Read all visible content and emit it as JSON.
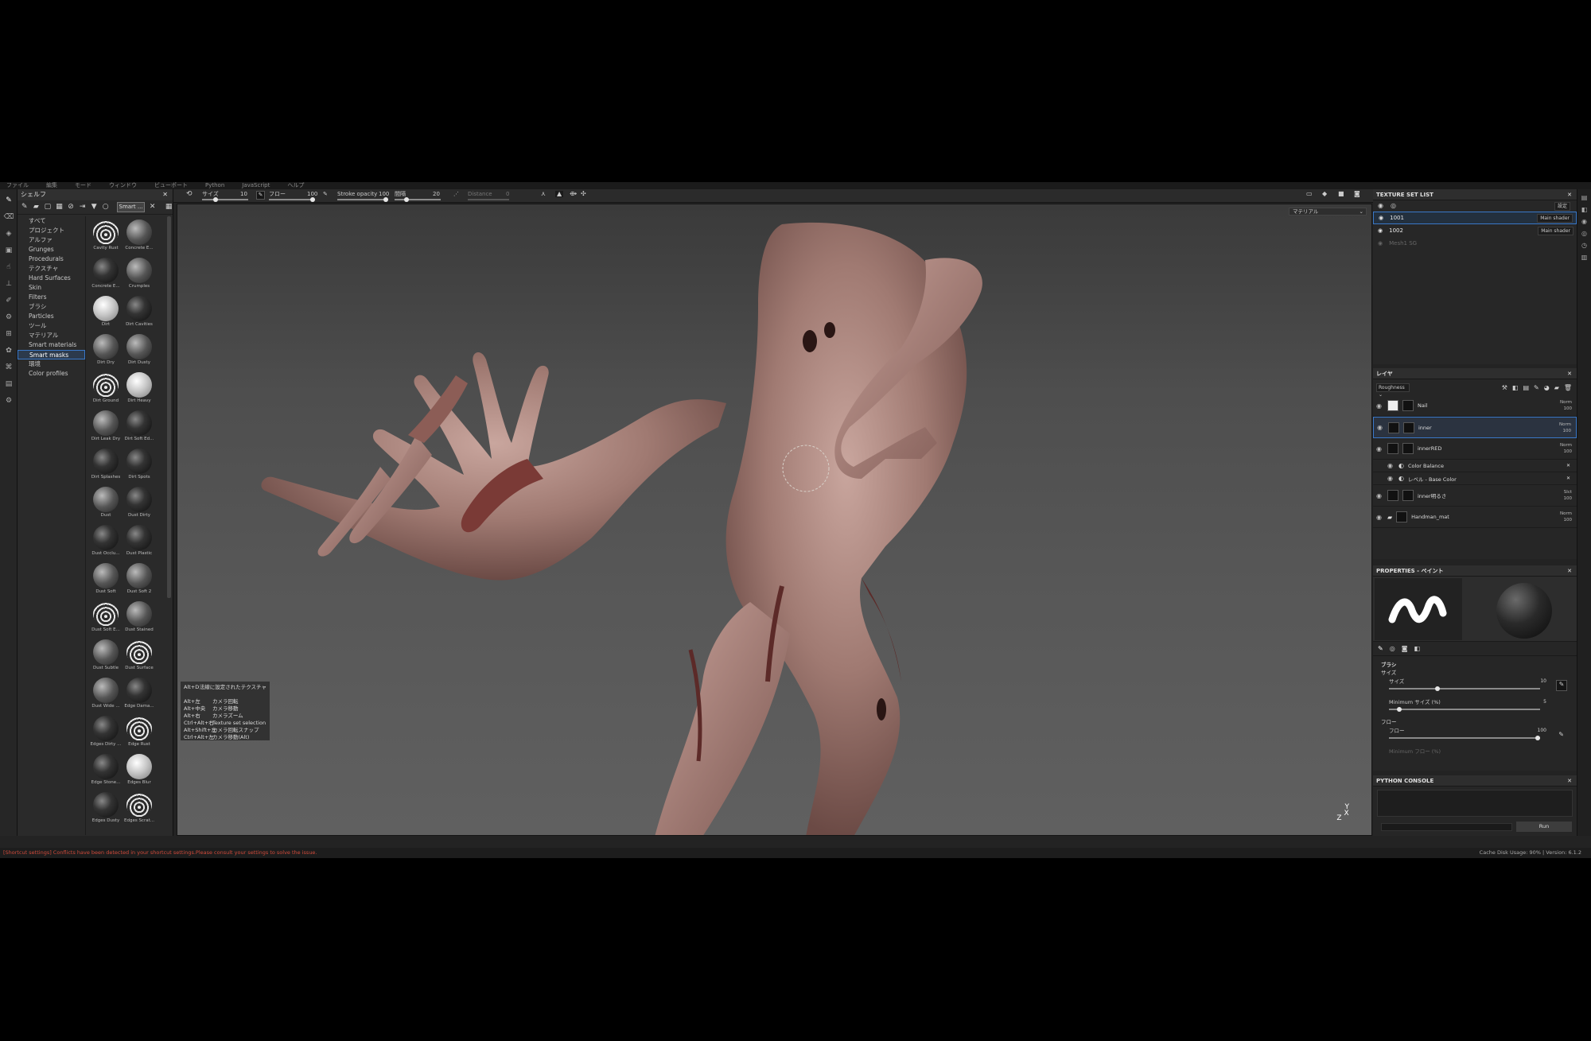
{
  "menu": [
    "ファイル",
    "編集",
    "モード",
    "ウィンドウ",
    "ビューポート",
    "Python",
    "JavaScript",
    "ヘルプ"
  ],
  "shelf": {
    "title": "シェルフ",
    "search_value": "Smart ...",
    "categories": [
      "すべて",
      "プロジェクト",
      "アルファ",
      "Grunges",
      "Procedurals",
      "テクスチャ",
      "Hard Surfaces",
      "Skin",
      "Filters",
      "ブラシ",
      "Particles",
      "ツール",
      "マテリアル",
      "Smart materials",
      "Smart masks",
      "環境",
      "Color profiles"
    ],
    "selected_category": "Smart masks",
    "items": [
      "Cavity Rust",
      "Concrete E...",
      "Concrete E...",
      "Crumples",
      "Dirt",
      "Dirt Cavities",
      "Dirt Dry",
      "Dirt Dusty",
      "Dirt Ground",
      "Dirt Heavy",
      "Dirt Leak Dry",
      "Dirt Soft Ed...",
      "Dirt Splashes",
      "Dirt Spots",
      "Dust",
      "Dust Dirty",
      "Dust Occlu...",
      "Dust Plastic",
      "Dust Soft",
      "Dust Soft 2",
      "Dust Soft E...",
      "Dust Stained",
      "Dust Subtle",
      "Dust Surface",
      "Dust Wide ...",
      "Edge Dama...",
      "Edges Dirty ...",
      "Edge Rust",
      "Edge Stone...",
      "Edges Blur",
      "Edges Dusty",
      "Edges Scrat..."
    ]
  },
  "toolbar": {
    "size_label": "サイズ",
    "size_value": "10",
    "flow_label": "フロー",
    "flow_value": "100",
    "stroke_opacity_label": "Stroke opacity",
    "stroke_opacity_value": "100",
    "spacing_label": "間隔",
    "spacing_value": "20",
    "distance_label": "Distance",
    "distance_value": "0"
  },
  "viewport": {
    "mode_select": "マテリアル",
    "shortcuts": [
      {
        "key": "Alt+D",
        "desc": "法線に設定されたテクスチャ"
      },
      {
        "key": "Alt+左",
        "desc": "カメラ回転"
      },
      {
        "key": "Alt+中央",
        "desc": "カメラ移動"
      },
      {
        "key": "Alt+右",
        "desc": "カメラズーム"
      },
      {
        "key": "Ctrl+Alt+右",
        "desc": "Texture set selection"
      },
      {
        "key": "Alt+Shift+左",
        "desc": "カメラ回転スナップ"
      },
      {
        "key": "Ctrl+Alt+左",
        "desc": "カメラ移動(Alt)"
      }
    ],
    "axis_labels": [
      "Z",
      "X",
      "Y"
    ]
  },
  "texture_set_list": {
    "title": "TEXTURE SET LIST",
    "settings_label": "設定",
    "sets": [
      {
        "name": "1001",
        "shader": "Main shader",
        "selected": true
      },
      {
        "name": "1002",
        "shader": "Main shader",
        "selected": false
      },
      {
        "name": "Mesh1 SG",
        "shader": "",
        "selected": false
      }
    ]
  },
  "layers": {
    "title": "レイヤ",
    "channel": "Roughness",
    "items": [
      {
        "name": "Nail",
        "blend": "Norm",
        "opacity": "100",
        "type": "paint",
        "selected": false
      },
      {
        "name": "inner",
        "blend": "Norm",
        "opacity": "100",
        "type": "paint",
        "selected": true
      },
      {
        "name": "innerRED",
        "blend": "Norm",
        "opacity": "100",
        "type": "fill",
        "selected": false
      },
      {
        "name": "Color Balance",
        "blend": "",
        "opacity": "",
        "type": "sub",
        "selected": false
      },
      {
        "name": "レベル - Base Color",
        "blend": "",
        "opacity": "",
        "type": "sub",
        "selected": false
      },
      {
        "name": "inner明るさ",
        "blend": "Slct",
        "opacity": "100",
        "type": "fill",
        "selected": false
      },
      {
        "name": "Handman_mat",
        "blend": "Norm",
        "opacity": "100",
        "type": "folder",
        "selected": false
      }
    ]
  },
  "properties": {
    "title": "PROPERTIES - ペイント",
    "section": "ブラシ",
    "size_group": "サイズ",
    "size_label": "サイズ",
    "size_value": "10",
    "min_size_label": "Minimum サイズ (%)",
    "min_size_value": "5",
    "flow_group": "フロー",
    "flow_label": "フロー",
    "flow_value": "100",
    "min_flow_label": "Minimum フロー (%)"
  },
  "python_console": {
    "title": "PYTHON CONSOLE",
    "run_label": "Run"
  },
  "status": {
    "message": "[Shortcut settings] Conflicts have been detected in your shortcut settings.Please consult your settings to solve the issue.",
    "cache": "Cache Disk Usage:",
    "cache_value": "90%",
    "version": "| Version: 6.1.2"
  }
}
